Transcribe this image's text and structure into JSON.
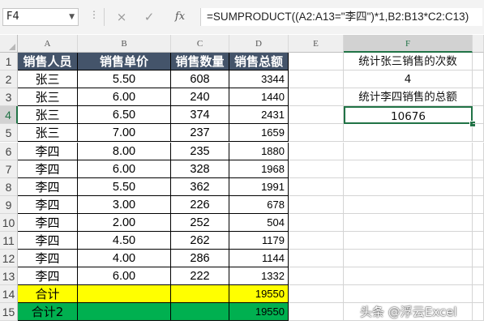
{
  "name_box": "F4",
  "formula_bar": {
    "formula": "=SUMPRODUCT((A2:A13=\"李四\")*1,B2:B13*C2:C13)",
    "cancel_icon": "×",
    "enter_icon": "✓",
    "fx_label": "fx"
  },
  "columns": [
    "A",
    "B",
    "C",
    "D",
    "E",
    "F"
  ],
  "selected_column": "F",
  "rows": [
    "1",
    "2",
    "3",
    "4",
    "5",
    "6",
    "7",
    "8",
    "9",
    "10",
    "11",
    "12",
    "13",
    "14",
    "15"
  ],
  "selected_row": "4",
  "table": {
    "headers": [
      "销售人员",
      "销售单价",
      "销售数量",
      "销售总额"
    ],
    "data": [
      [
        "张三",
        "5.50",
        "608",
        "3344"
      ],
      [
        "张三",
        "6.00",
        "240",
        "1440"
      ],
      [
        "张三",
        "6.50",
        "374",
        "2431"
      ],
      [
        "张三",
        "7.00",
        "237",
        "1659"
      ],
      [
        "李四",
        "8.00",
        "235",
        "1880"
      ],
      [
        "李四",
        "6.00",
        "328",
        "1968"
      ],
      [
        "李四",
        "5.50",
        "362",
        "1991"
      ],
      [
        "李四",
        "3.00",
        "226",
        "678"
      ],
      [
        "李四",
        "2.00",
        "252",
        "504"
      ],
      [
        "李四",
        "4.50",
        "262",
        "1179"
      ],
      [
        "李四",
        "4.00",
        "286",
        "1144"
      ],
      [
        "李四",
        "6.00",
        "222",
        "1332"
      ]
    ],
    "total_label": "合计",
    "total_value": "19550",
    "total2_label": "合计2",
    "total2_value": "19550"
  },
  "column_f": {
    "f1": "统计张三销售的次数",
    "f2": "4",
    "f3": "统计李四销售的总额",
    "f4": "10676"
  },
  "watermark": "头条 @浮云Excel",
  "colors": {
    "header_bg": "#44546a",
    "total_bg": "#ffff00",
    "total2_bg": "#00b050",
    "selection": "#217346"
  }
}
